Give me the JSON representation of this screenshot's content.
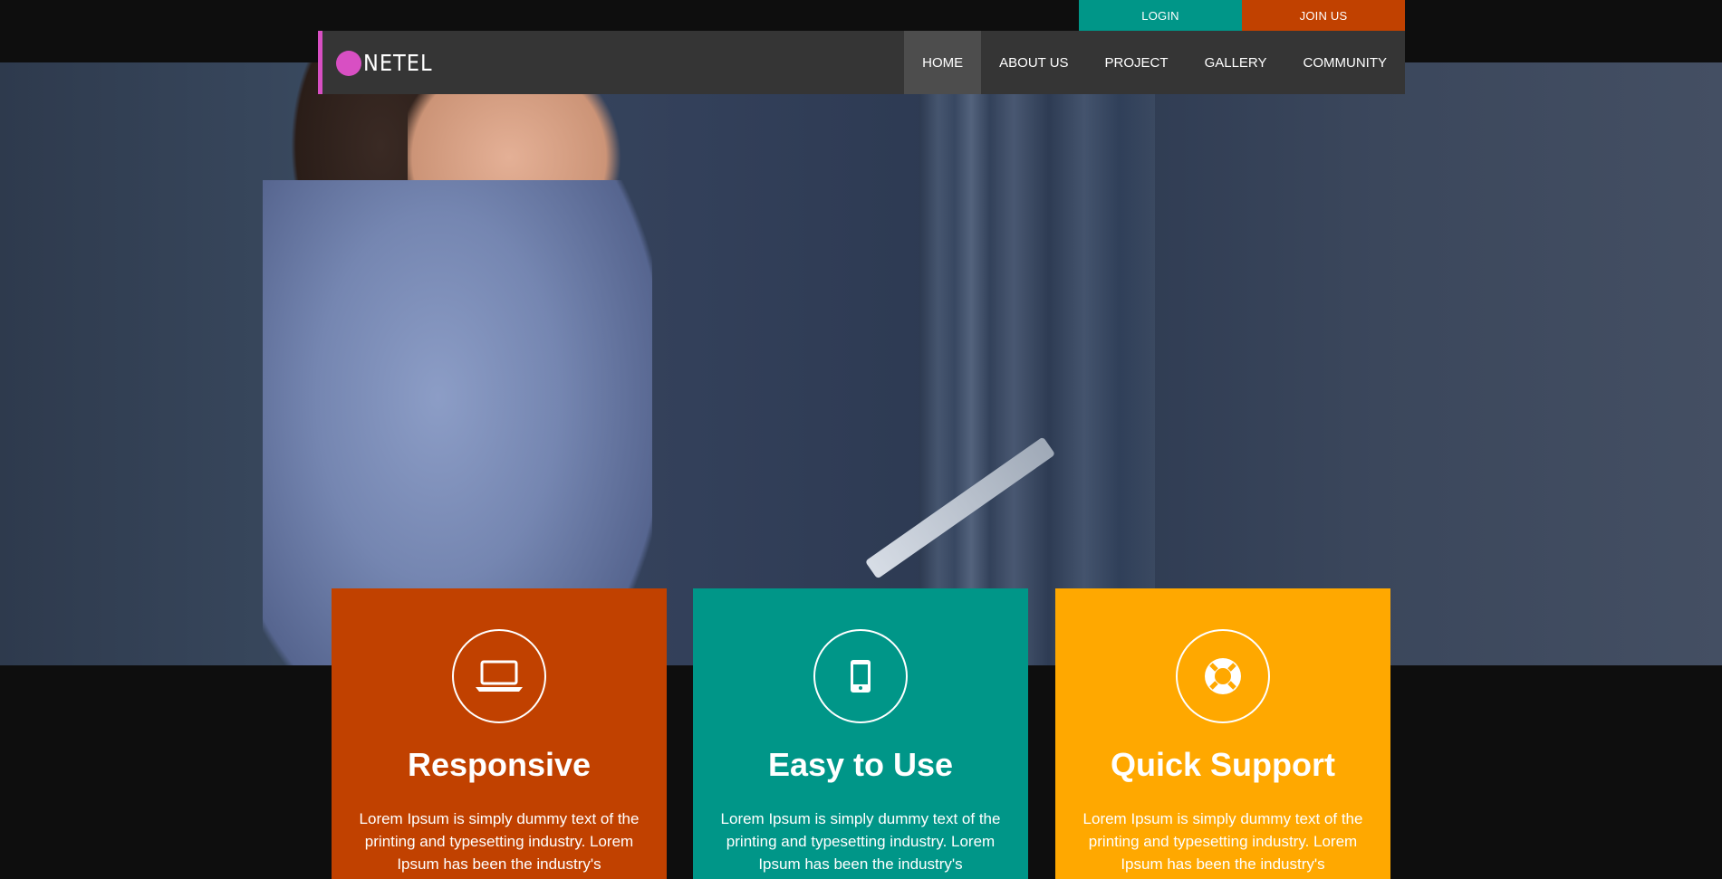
{
  "topbar": {
    "login_label": "LOGIN",
    "join_label": "JOIN US"
  },
  "brand": {
    "name": "NETEL"
  },
  "nav": {
    "items": [
      {
        "label": "HOME",
        "active": true
      },
      {
        "label": "ABOUT US",
        "active": false
      },
      {
        "label": "PROJECT",
        "active": false
      },
      {
        "label": "GALLERY",
        "active": false
      },
      {
        "label": "COMMUNITY",
        "active": false
      }
    ]
  },
  "features": [
    {
      "icon": "laptop-icon",
      "title": "Responsive",
      "text": "Lorem Ipsum is simply dummy text of the printing and typesetting industry. Lorem Ipsum has been the industry's",
      "color": "#c14100"
    },
    {
      "icon": "mobile-icon",
      "title": "Easy to Use",
      "text": "Lorem Ipsum is simply dummy text of the printing and typesetting industry. Lorem Ipsum has been the industry's",
      "color": "#009688"
    },
    {
      "icon": "life-ring-icon",
      "title": "Quick Support",
      "text": "Lorem Ipsum is simply dummy text of the printing and typesetting industry. Lorem Ipsum has been the industry's",
      "color": "#ffa800"
    }
  ],
  "colors": {
    "accent": "#d84fc3",
    "login": "#009688",
    "join": "#c14100",
    "navbar": "#353535"
  }
}
